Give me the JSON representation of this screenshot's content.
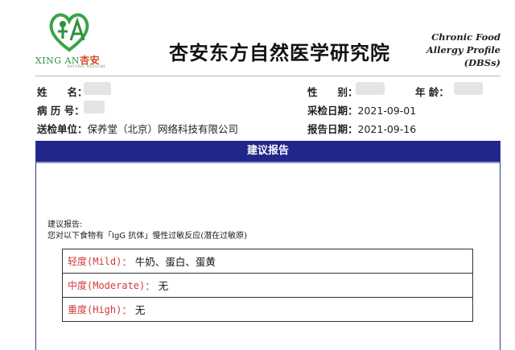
{
  "logo": {
    "brand_en": "XING AN",
    "brand_cn": "杏安",
    "tagline": "NATURAL MEDICINE"
  },
  "institution_name": "杏安东方自然医学研究院",
  "report_type_lines": [
    "Chronic Food",
    "Allergy Profile",
    "(DBSs)"
  ],
  "patient": {
    "name_label": "姓　　名：",
    "gender_label": "性　　别：",
    "age_label": "年 龄：",
    "record_label": "病 历 号：",
    "sample_date_label": "采检日期：",
    "sample_date": "2021-09-01",
    "org_label": "送检单位：",
    "org_value": "保养堂（北京）网络科技有限公司",
    "report_date_label": "报告日期：",
    "report_date": "2021-09-16"
  },
  "section": {
    "title": "建议报告",
    "intro_line1": "建议报告:",
    "intro_line2": "您对以下食物有「IgG 抗体」慢性过敏反应(潜在过敏原)"
  },
  "results": [
    {
      "level": "轻度(Mild)",
      "value": "牛奶、蛋白、蛋黄"
    },
    {
      "level": "中度(Moderate)",
      "value": "无"
    },
    {
      "level": "重度(High)",
      "value": "无"
    }
  ],
  "colors": {
    "header_bar": "#22268a",
    "level_text": "#d23a3a",
    "logo_green": "#2f8f3a",
    "logo_red": "#d8492a"
  }
}
